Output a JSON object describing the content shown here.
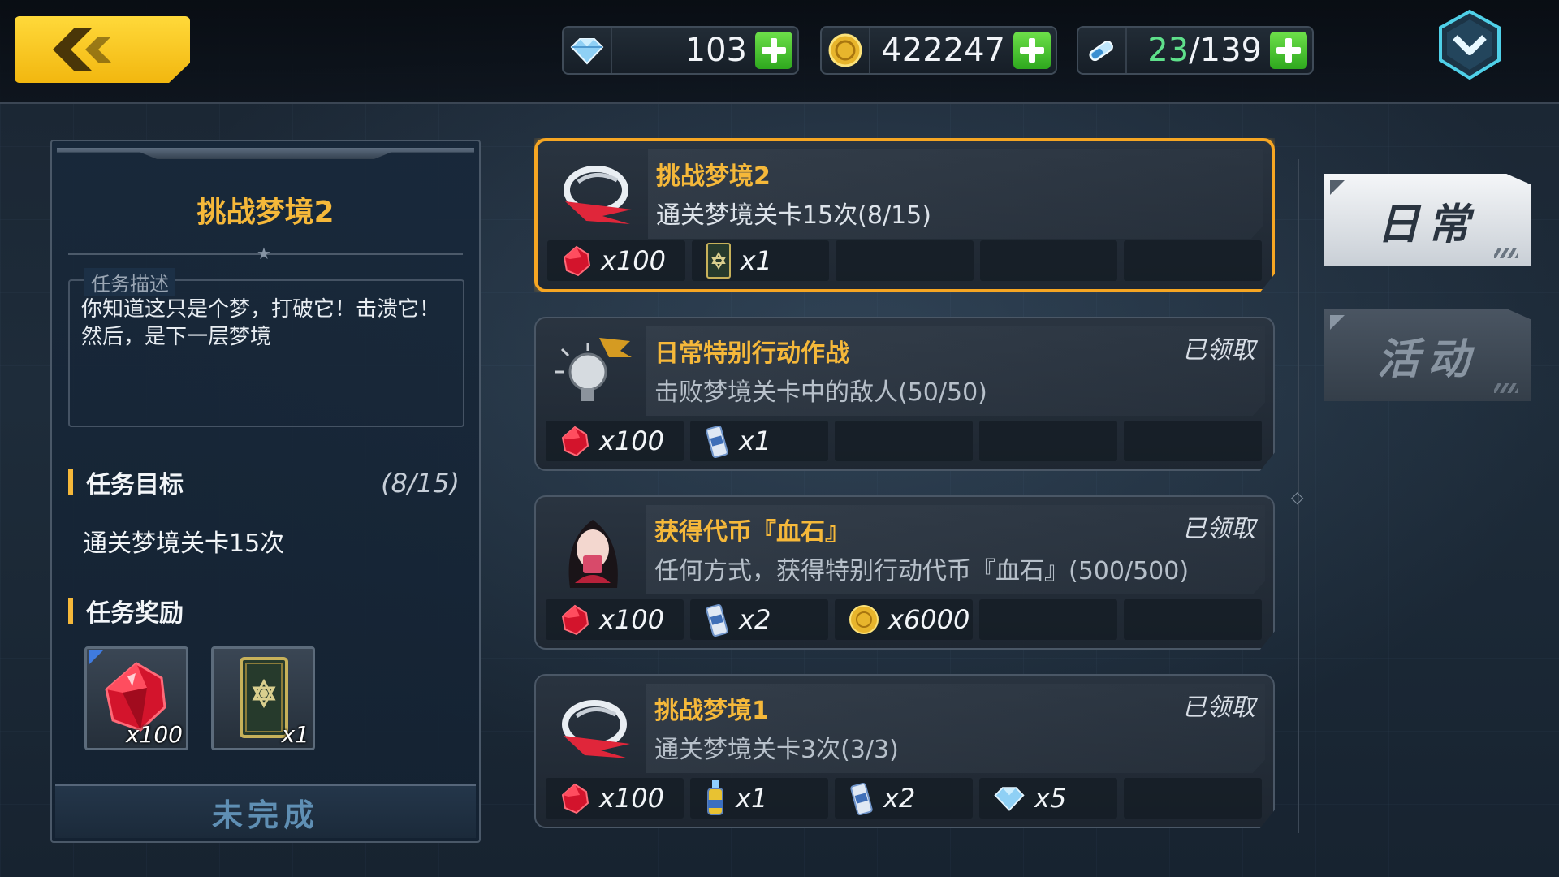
{
  "resources": {
    "crystal": "103",
    "gold": "422247",
    "stamina_current": "23",
    "stamina_max": "/139"
  },
  "detail": {
    "title": "挑战梦境2",
    "desc_label": "任务描述",
    "description": "你知道这只是个梦，打破它！击溃它！然后，是下一层梦境",
    "goal_heading": "任务目标",
    "goal_count": "(8/15)",
    "goal_text": "通关梦境关卡15次",
    "reward_heading": "任务奖励",
    "rewards": [
      {
        "icon": "red-gem-icon",
        "qty": "x100"
      },
      {
        "icon": "card-icon",
        "qty": "x1"
      }
    ],
    "status": "未完成"
  },
  "missions": [
    {
      "title": "挑战梦境2",
      "desc": "通关梦境关卡15次(8/15)",
      "claimed": "",
      "rewards": [
        {
          "icon": "red-gem-icon",
          "qty": "x100"
        },
        {
          "icon": "card-icon",
          "qty": "x1"
        }
      ]
    },
    {
      "title": "日常特别行动作战",
      "desc": "击败梦境关卡中的敌人(50/50)",
      "claimed": "已领取",
      "rewards": [
        {
          "icon": "red-gem-icon",
          "qty": "x100"
        },
        {
          "icon": "ap-drink-icon",
          "qty": "x1"
        }
      ]
    },
    {
      "title": "获得代币『血石』",
      "desc": "任何方式，获得特别行动代币『血石』(500/500)",
      "claimed": "已领取",
      "rewards": [
        {
          "icon": "red-gem-icon",
          "qty": "x100"
        },
        {
          "icon": "ap-drink-icon",
          "qty": "x2"
        },
        {
          "icon": "gold-coin-icon",
          "qty": "x6000"
        }
      ]
    },
    {
      "title": "挑战梦境1",
      "desc": "通关梦境关卡3次(3/3)",
      "claimed": "已领取",
      "rewards": [
        {
          "icon": "red-gem-icon",
          "qty": "x100"
        },
        {
          "icon": "exp-bottle-icon",
          "qty": "x1"
        },
        {
          "icon": "ap-drink-icon",
          "qty": "x2"
        },
        {
          "icon": "crystal-icon",
          "qty": "x5"
        }
      ]
    }
  ],
  "tabs": {
    "daily": "日常",
    "event": "活动"
  },
  "colors": {
    "accent": "#f5b83a",
    "selected_border": "#f6a623",
    "plus_green": "#3cc229"
  }
}
